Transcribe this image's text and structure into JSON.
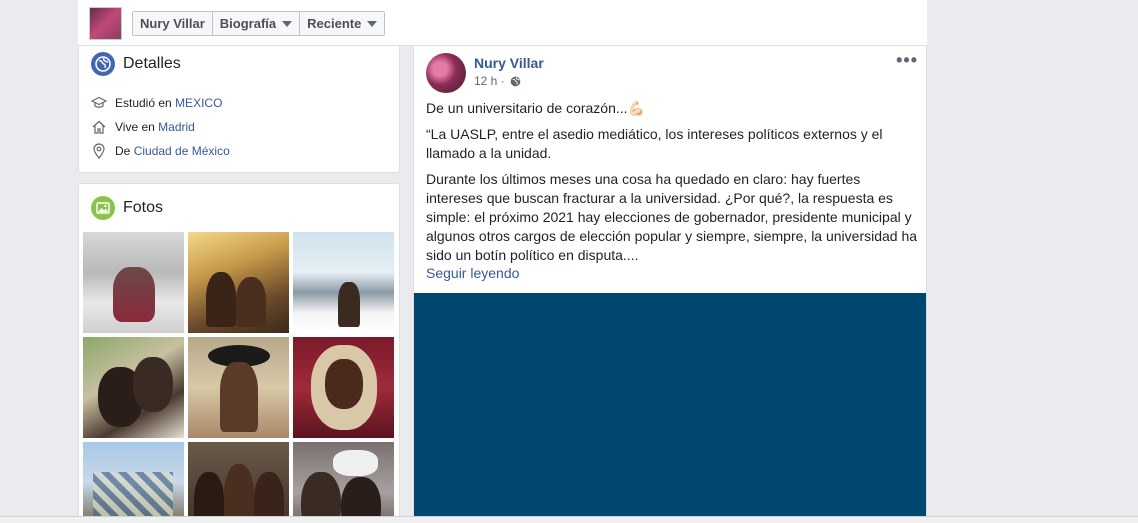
{
  "topbar": {
    "name": "Nury Villar",
    "tabs": [
      {
        "label": "Biografía"
      },
      {
        "label": "Reciente"
      }
    ]
  },
  "details": {
    "title": "Detalles",
    "studied_prefix": "Estudió en",
    "studied_place": "MEXICO",
    "lives_prefix": "Vive en",
    "lives_place": "Madrid",
    "from_prefix": "De",
    "from_place": "Ciudad de México"
  },
  "photos": {
    "title": "Fotos"
  },
  "post": {
    "author": "Nury Villar",
    "time": "12 h ·",
    "line1": "De un universitario de corazón...",
    "emoji": "💪🏻",
    "quote": "“La UASLP, entre el asedio mediático, los intereses políticos externos y el llamado a la unidad.",
    "body": "Durante los últimos meses una cosa ha quedado en claro: hay fuertes intereses que buscan fracturar a la universidad. ¿Por qué?, la respuesta es simple: el próximo 2021 hay elecciones de gobernador, presidente municipal y algunos otros cargos de elección popular y siempre, siempre, la universidad ha sido un botín político en disputa....",
    "see_more": "Seguir leyendo"
  },
  "colors": {
    "link": "#365899",
    "media_bg": "#00476f",
    "globe_badge": "#4267b2",
    "photo_badge": "#8bc34a"
  }
}
